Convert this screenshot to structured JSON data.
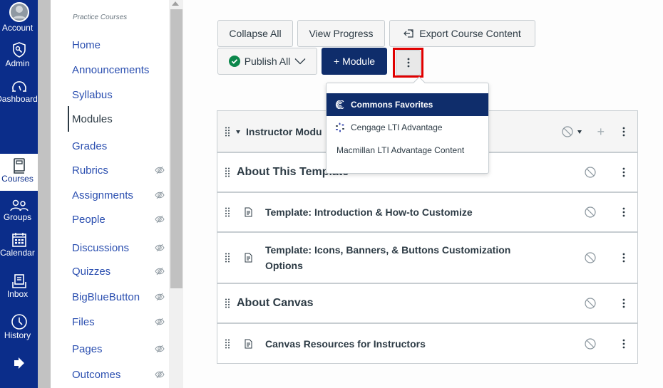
{
  "global_nav": {
    "items": [
      {
        "label": "Account",
        "icon": "account-icon",
        "active": false
      },
      {
        "label": "Admin",
        "icon": "admin-shield-icon",
        "active": false
      },
      {
        "label": "Dashboard",
        "icon": "dashboard-gauge-icon",
        "active": false
      },
      {
        "label": "Courses",
        "icon": "courses-book-icon",
        "active": true
      },
      {
        "label": "Groups",
        "icon": "groups-icon",
        "active": false
      },
      {
        "label": "Calendar",
        "icon": "calendar-icon",
        "active": false
      },
      {
        "label": "Inbox",
        "icon": "inbox-icon",
        "active": false
      },
      {
        "label": "History",
        "icon": "history-clock-icon",
        "active": false
      },
      {
        "label": "",
        "icon": "collapse-arrow-icon",
        "active": false
      }
    ]
  },
  "course_nav": {
    "course_title": "Practice Courses",
    "items": [
      {
        "label": "Home",
        "hidden": false,
        "active": false
      },
      {
        "label": "Announcements",
        "hidden": false,
        "active": false
      },
      {
        "label": "Syllabus",
        "hidden": false,
        "active": false
      },
      {
        "label": "Modules",
        "hidden": false,
        "active": true
      },
      {
        "label": "Grades",
        "hidden": false,
        "active": false
      },
      {
        "label": "Rubrics",
        "hidden": true,
        "active": false
      },
      {
        "label": "Assignments",
        "hidden": true,
        "active": false
      },
      {
        "label": "People",
        "hidden": true,
        "active": false
      },
      {
        "label": "Discussions",
        "hidden": true,
        "active": false
      },
      {
        "label": "Quizzes",
        "hidden": true,
        "active": false
      },
      {
        "label": "BigBlueButton",
        "hidden": true,
        "active": false
      },
      {
        "label": "Files",
        "hidden": true,
        "active": false
      },
      {
        "label": "Pages",
        "hidden": true,
        "active": false
      },
      {
        "label": "Outcomes",
        "hidden": true,
        "active": false
      }
    ]
  },
  "toolbar": {
    "collapse_all": "Collapse All",
    "view_progress": "View Progress",
    "export_course_content": "Export Course Content",
    "publish_all": "Publish All",
    "add_module": "+ Module",
    "more_options": "⋮"
  },
  "tools_menu": {
    "items": [
      {
        "label": "Commons Favorites",
        "icon": "commons-icon",
        "active": true
      },
      {
        "label": "Cengage LTI Advantage",
        "icon": "cengage-icon",
        "active": false
      },
      {
        "label": "Macmillan LTI Advantage Content",
        "icon": "",
        "active": false
      }
    ]
  },
  "modules": {
    "header": {
      "title": "Instructor Modules",
      "title_visible": "Instructor Modu"
    },
    "rows": [
      {
        "type": "subheader",
        "title": "About This Template"
      },
      {
        "type": "page",
        "title": "Template: Introduction & How-to Customize"
      },
      {
        "type": "page",
        "title": "Template: Icons, Banners, & Buttons Customization Options"
      },
      {
        "type": "subheader",
        "title": "About Canvas"
      },
      {
        "type": "page",
        "title": "Canvas Resources for Instructors"
      }
    ]
  },
  "colors": {
    "global_nav_bg": "#0b2d8a",
    "primary_button": "#0f2d6b",
    "link": "#2b4fb0",
    "text": "#2d3b45",
    "publish_green": "#0b874b",
    "highlight_red": "#e00000"
  }
}
